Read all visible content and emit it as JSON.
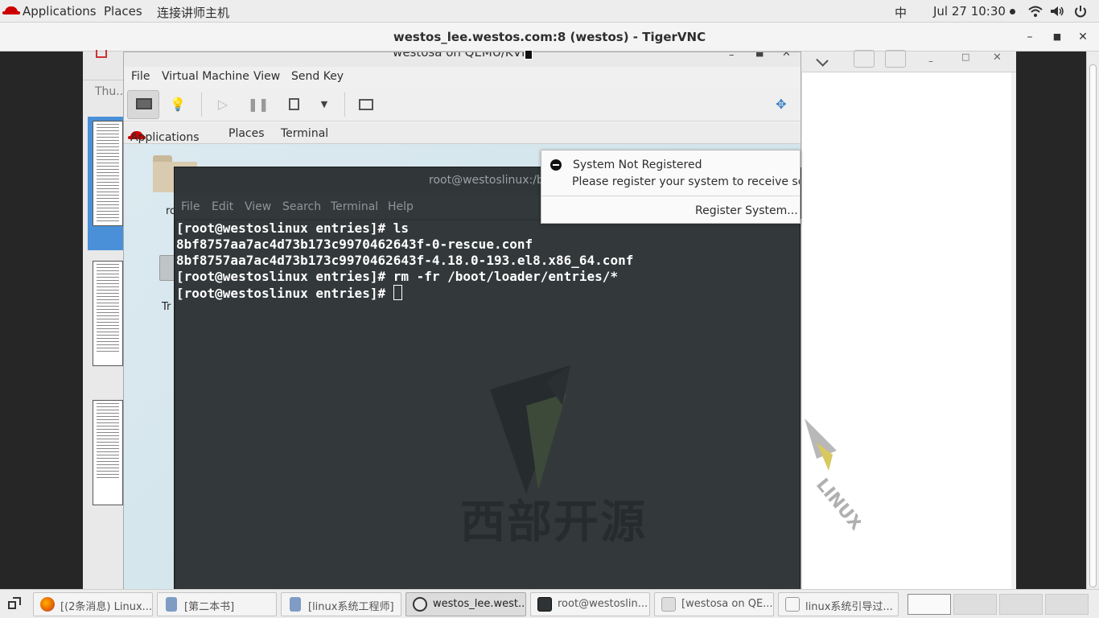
{
  "host_topbar": {
    "applications": "Applications",
    "places": "Places",
    "connect": "连接讲师主机",
    "input_method": "中",
    "clock": "Jul 27  10:30"
  },
  "vnc_window": {
    "title": "westos_lee.westos.com:8 (westos) - TigerVNC"
  },
  "doc_viewer": {
    "sidebar_label": "Thu..."
  },
  "vm_window": {
    "title": "westosa on QEMU/KVM",
    "menu": [
      "File",
      "Virtual Machine",
      "View",
      "Send Key"
    ]
  },
  "guest_topbar": {
    "applications": "Applications",
    "places": "Places",
    "terminal": "Terminal"
  },
  "guest_desktop": {
    "home_label": "ro",
    "trash_label": "Tr"
  },
  "terminal": {
    "title": "root@westoslinux:/b",
    "menu": [
      "File",
      "Edit",
      "View",
      "Search",
      "Terminal",
      "Help"
    ],
    "lines": [
      "[root@westoslinux entries]# ls",
      "8bf8757aa7ac4d73b173c9970462643f-0-rescue.conf",
      "8bf8757aa7ac4d73b173c9970462643f-4.18.0-193.el8.x86_64.conf",
      "[root@westoslinux entries]# rm -fr /boot/loader/entries/*",
      "[root@westoslinux entries]# "
    ],
    "watermark": "西部开源"
  },
  "notification": {
    "title": "System Not Registered",
    "body": "Please register your system to receive softw",
    "action": "Register System..."
  },
  "taskbar": {
    "items": [
      {
        "label": "[(2条消息) Linux...",
        "active": false,
        "icon": "firefox-icon"
      },
      {
        "label": "[第二本书]",
        "active": false,
        "icon": "document-icon"
      },
      {
        "label": "[linux系统工程师]",
        "active": false,
        "icon": "document-icon"
      },
      {
        "label": "westos_lee.west...",
        "active": true,
        "icon": "vnc-icon"
      },
      {
        "label": "root@westoslin...",
        "active": false,
        "icon": "terminal-icon"
      },
      {
        "label": "[westosa on QE...",
        "active": false,
        "icon": "vm-icon"
      },
      {
        "label": "linux系统引导过...",
        "active": false,
        "icon": "text-editor-icon"
      }
    ]
  },
  "colors": {
    "redhat": "#cc0000",
    "terminal_bg": "#33393b",
    "selection": "#4a90d9"
  }
}
